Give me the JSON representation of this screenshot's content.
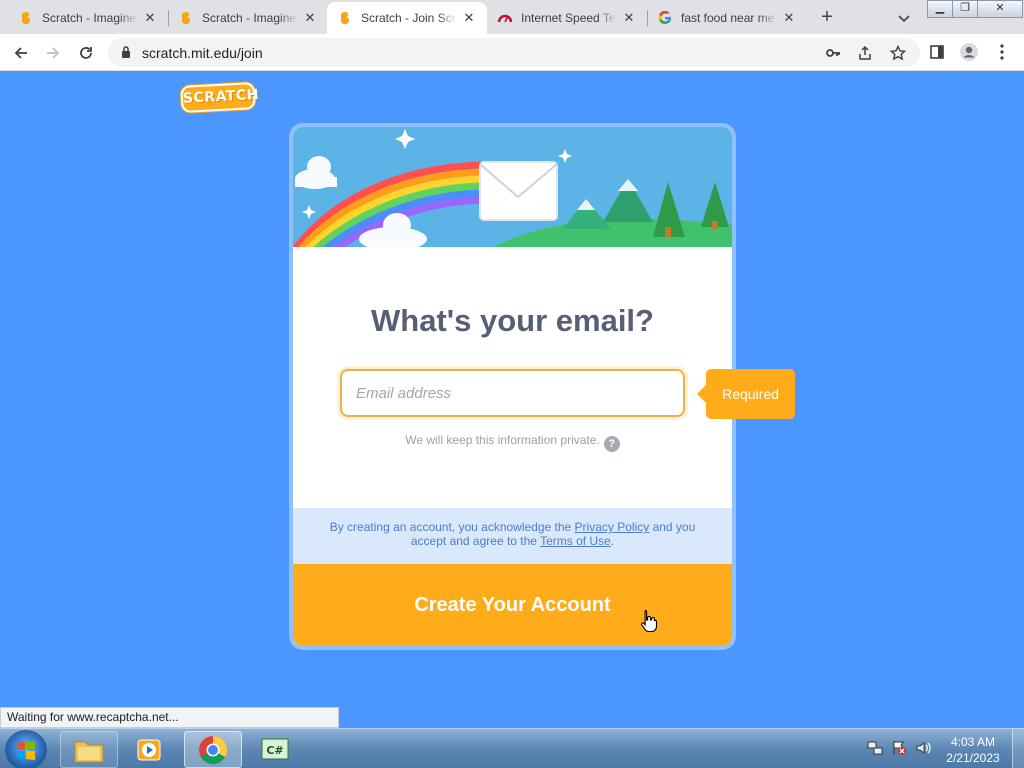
{
  "browser": {
    "tabs": [
      {
        "title": "Scratch - Imagine, Program, Share",
        "favicon": "scratch-icon",
        "active": false
      },
      {
        "title": "Scratch - Imagine, Program, Share",
        "favicon": "scratch-icon",
        "active": false
      },
      {
        "title": "Scratch - Join Scratch",
        "favicon": "scratch-icon",
        "active": true
      },
      {
        "title": "Internet Speed Test",
        "favicon": "speedometer-icon",
        "active": false
      },
      {
        "title": "fast food near me",
        "favicon": "google-icon",
        "active": false
      }
    ],
    "address": "scratch.mit.edu/join",
    "status_text": "Waiting for www.recaptcha.net..."
  },
  "page": {
    "logo_text": "SCRATCH",
    "heading": "What's your email?",
    "email_placeholder": "Email address",
    "email_value": "",
    "required_label": "Required",
    "private_note": "We will keep this information private.",
    "help_symbol": "?",
    "terms_prefix": "By creating an account, you acknowledge the ",
    "privacy_link": "Privacy Policy",
    "terms_middle": " and you accept and agree to the ",
    "terms_link": "Terms of Use",
    "terms_suffix": ".",
    "create_button": "Create Your Account"
  },
  "taskbar": {
    "items": [
      "start-button",
      "file-explorer",
      "media-player",
      "chrome",
      "csharp-app"
    ],
    "clock_time": "4:03 AM",
    "clock_date": "2/21/2023"
  },
  "colors": {
    "page_background": "#4c97ff",
    "scratch_orange": "#ffab1a",
    "heading_text": "#575e75",
    "terms_background": "#d9e8fd"
  }
}
